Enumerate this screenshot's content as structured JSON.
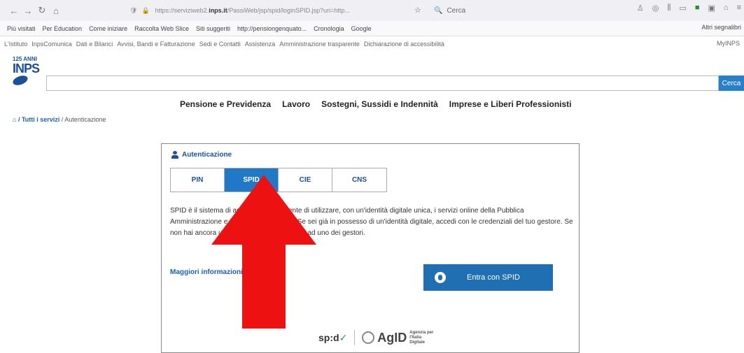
{
  "browser": {
    "url_prefix": "https://serviziweb2.",
    "url_host": "inps.it",
    "url_rest": "/PassiWeb/jsp/spid/loginSPID.jsp?uri=http...",
    "search_placeholder": "Cerca"
  },
  "bookmarks": {
    "items": [
      "Più visitati",
      "Per Education",
      "Come iniziare",
      "Raccolta Web Slice",
      "Siti suggeriti",
      "http://pensiongenquato...",
      "Cronologia",
      "Google"
    ],
    "other": "Altri segnalibri"
  },
  "inps_nav": {
    "items": [
      "L'Istituto",
      "InpsComunica",
      "Dati e Bilanci",
      "Avvisi, Bandi e Fatturazione",
      "Sedi e Contatti",
      "Assistenza",
      "Amministrazione trasparente",
      "Dichiarazione di accessibilità"
    ],
    "myinps": "MyINPS"
  },
  "logo": {
    "small": "125 ANNI",
    "big": "INPS"
  },
  "search": {
    "button": "Cerca"
  },
  "menu": [
    "Pensione e Previdenza",
    "Lavoro",
    "Sostegni, Sussidi e Indennità",
    "Imprese e Liberi Professionisti"
  ],
  "breadcrumb": {
    "link": "/ Tutti i servizi",
    "current": " / Autenticazione"
  },
  "auth": {
    "title": "Autenticazione",
    "tabs": [
      "PIN",
      "SPID",
      "CIE",
      "CNS"
    ],
    "active_tab": "SPID",
    "description": "SPID è il sistema di accesso che consente di utilizzare, con un'identità digitale unica, i servizi online della Pubblica Amministrazione e dei privati accreditati. Se sei già in possesso di un'identità digitale, accedi con le credenziali del tuo gestore. Se non hai ancora un'identità digitale, richiedila ad uno dei gestori.",
    "more_link": "Maggiori informazioni su SPID",
    "spid_button": "Entra con SPID"
  },
  "footer": {
    "spid_logo": "sp:d",
    "agid": "AgID",
    "agid_sub": "Agenzia per l'Italia Digitale"
  },
  "colors": {
    "accent": "#2079c7",
    "arrow": "#ee1111"
  }
}
